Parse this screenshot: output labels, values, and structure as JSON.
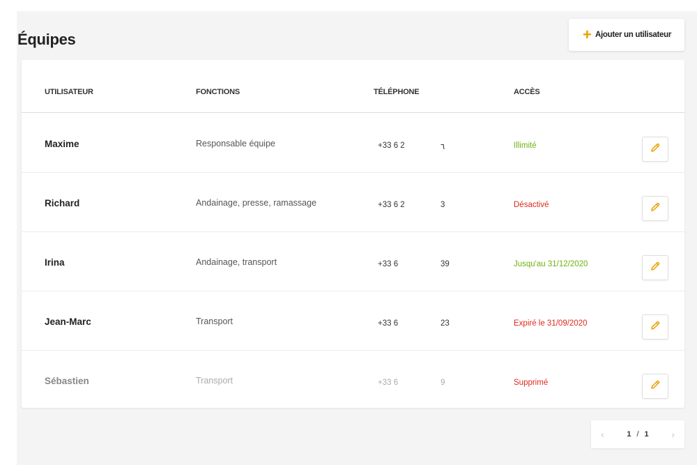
{
  "page": {
    "title": "Équipes"
  },
  "toolbar": {
    "add_icon": "plus-icon",
    "add_label": "Ajouter un utilisateur",
    "accent": "#e8a100"
  },
  "table": {
    "headers": {
      "user": "UTILISATEUR",
      "functions": "FONCTIONS",
      "phone": "TÉLÉPHONE",
      "access": "ACCÈS"
    },
    "rows": [
      {
        "name": "Maxime",
        "functions": "Responsable équipe",
        "phone_start": "+33 6 2",
        "phone_end": "٦",
        "access": "Illimité",
        "access_color": "#6cb30f",
        "edit_icon": "pencil-icon"
      },
      {
        "name": "Richard",
        "functions": "Andainage, presse, ramassage",
        "phone_start": "+33 6 2",
        "phone_end": "3",
        "access": "Désactivé",
        "access_color": "#e0281c",
        "edit_icon": "pencil-icon"
      },
      {
        "name": "Irina",
        "functions": "Andainage, transport",
        "phone_start": "+33 6",
        "phone_end": "39",
        "access": "Jusqu'au 31/12/2020",
        "access_color": "#6cb30f",
        "edit_icon": "pencil-icon"
      },
      {
        "name": "Jean-Marc",
        "functions": "Transport",
        "phone_start": "+33 6",
        "phone_end": "23",
        "access": "Expiré le 31/09/2020",
        "access_color": "#e0281c",
        "edit_icon": "pencil-icon"
      },
      {
        "name": "Sébastien",
        "functions": "Transport",
        "phone_start": "+33 6",
        "phone_end": "9",
        "access": "Supprimé",
        "access_color": "#e0281c",
        "edit_icon": "pencil-icon"
      }
    ]
  },
  "pagination": {
    "current": "1",
    "separator": "/",
    "total": "1",
    "prev_icon": "chevron-left-icon",
    "next_icon": "chevron-right-icon"
  }
}
